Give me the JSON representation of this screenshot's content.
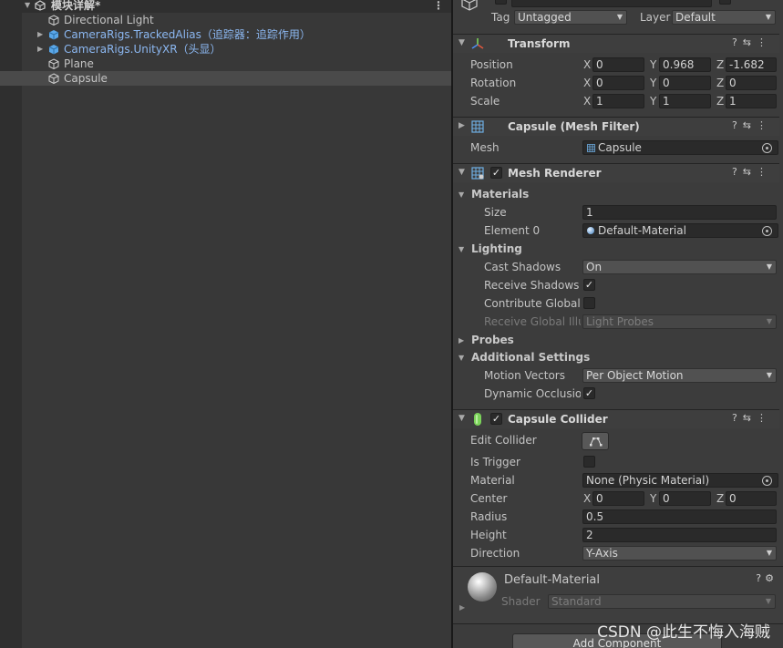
{
  "hierarchy": {
    "scene_name": "模块详解*",
    "items": [
      {
        "label": "Directional Light"
      },
      {
        "label": "CameraRigs.TrackedAlias（追踪器：追踪作用）"
      },
      {
        "label": "CameraRigs.UnityXR（头显）"
      },
      {
        "label": "Plane"
      },
      {
        "label": "Capsule"
      }
    ]
  },
  "inspector": {
    "tag_label": "Tag",
    "tag_value": "Untagged",
    "layer_label": "Layer",
    "layer_value": "Default",
    "transform": {
      "title": "Transform",
      "rows": [
        {
          "label": "Position",
          "x": "0",
          "y": "0.968",
          "z": "-1.682"
        },
        {
          "label": "Rotation",
          "x": "0",
          "y": "0",
          "z": "0"
        },
        {
          "label": "Scale",
          "x": "1",
          "y": "1",
          "z": "1"
        }
      ],
      "axis_x": "X",
      "axis_y": "Y",
      "axis_z": "Z"
    },
    "mesh_filter": {
      "title": "Capsule (Mesh Filter)",
      "mesh_label": "Mesh",
      "mesh_value": "Capsule"
    },
    "mesh_renderer": {
      "title": "Mesh Renderer",
      "enabled": true,
      "materials_label": "Materials",
      "size_label": "Size",
      "size_value": "1",
      "element0_label": "Element 0",
      "element0_value": "Default-Material",
      "lighting_label": "Lighting",
      "cast_shadows_label": "Cast Shadows",
      "cast_shadows_value": "On",
      "receive_shadows_label": "Receive Shadows",
      "receive_shadows": true,
      "contribute_gi_label": "Contribute Global Il",
      "contribute_gi": false,
      "receive_gi_label": "Receive Global Illu",
      "receive_gi_value": "Light Probes",
      "probes_label": "Probes",
      "additional_label": "Additional Settings",
      "motion_vectors_label": "Motion Vectors",
      "motion_vectors_value": "Per Object Motion",
      "dynamic_occlusion_label": "Dynamic Occlusion",
      "dynamic_occlusion": true
    },
    "capsule_collider": {
      "title": "Capsule Collider",
      "enabled": true,
      "edit_collider_label": "Edit Collider",
      "is_trigger_label": "Is Trigger",
      "is_trigger": false,
      "material_label": "Material",
      "material_value": "None (Physic Material)",
      "center_label": "Center",
      "center_x": "0",
      "center_y": "0",
      "center_z": "0",
      "radius_label": "Radius",
      "radius_value": "0.5",
      "height_label": "Height",
      "height_value": "2",
      "direction_label": "Direction",
      "direction_value": "Y-Axis"
    },
    "material_preview": {
      "name": "Default-Material",
      "shader_label": "Shader",
      "shader_value": "Standard"
    },
    "add_component_label": "Add Component",
    "help_icon": "?",
    "check_mark": "✓"
  },
  "watermark": "CSDN @此生不悔入海贼",
  "colors": {
    "prefab_text": "#8cb8f2",
    "selection": "#4a4a4a",
    "panel_bg": "#383838",
    "inspector_bg": "#3c3c3c"
  }
}
